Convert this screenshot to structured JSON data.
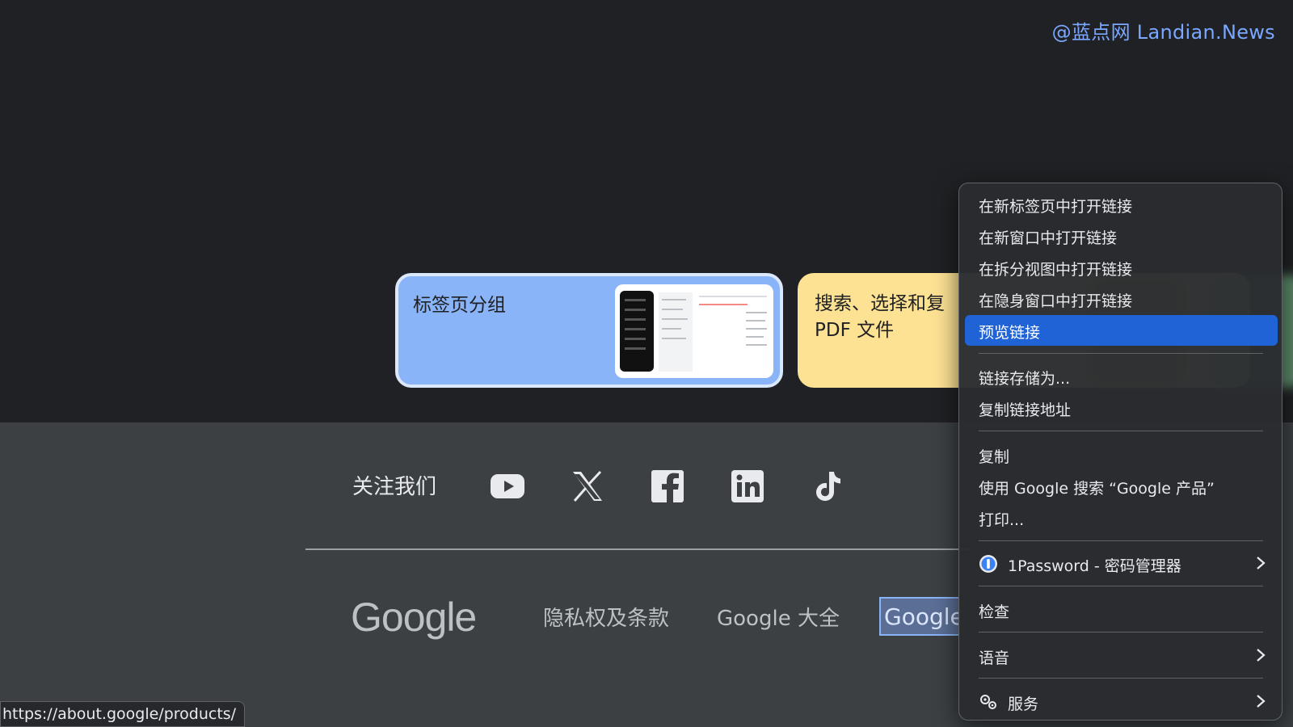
{
  "watermark": "@蓝点网 Landian.News",
  "cards": {
    "tabs_title": "标签页分组",
    "pdf_title_line1": "搜索、选择和复",
    "pdf_title_line2": "PDF 文件"
  },
  "footer": {
    "follow_label": "关注我们",
    "social": [
      "youtube-icon",
      "x-icon",
      "facebook-icon",
      "linkedin-icon",
      "tiktok-icon"
    ],
    "google_logo": "Google",
    "links": [
      "隐私权及条款",
      "Google 大全",
      "Google"
    ]
  },
  "status_url": "https://about.google/products/",
  "context_menu": {
    "items": [
      {
        "label": "在新标签页中打开链接"
      },
      {
        "label": "在新窗口中打开链接"
      },
      {
        "label": "在拆分视图中打开链接"
      },
      {
        "label": "在隐身窗口中打开链接"
      },
      {
        "label": "预览链接",
        "active": true
      },
      {
        "label": "链接存储为..."
      },
      {
        "label": "复制链接地址"
      },
      {
        "label": "复制"
      },
      {
        "label": "使用 Google 搜索 “Google 产品”"
      },
      {
        "label": "打印..."
      },
      {
        "label": "1Password - 密码管理器",
        "icon": "1password-icon",
        "submenu": true
      },
      {
        "label": "检查"
      },
      {
        "label": "语音",
        "submenu": true
      },
      {
        "label": "服务",
        "icon": "services-gear-icon",
        "submenu": true
      }
    ]
  },
  "colors": {
    "page_bg": "#202124",
    "footer_bg": "#3c4043",
    "card_blue": "#8ab4f8",
    "card_yellow": "#fde293",
    "menu_highlight": "#1f63d6",
    "watermark": "#7aa7ff"
  }
}
